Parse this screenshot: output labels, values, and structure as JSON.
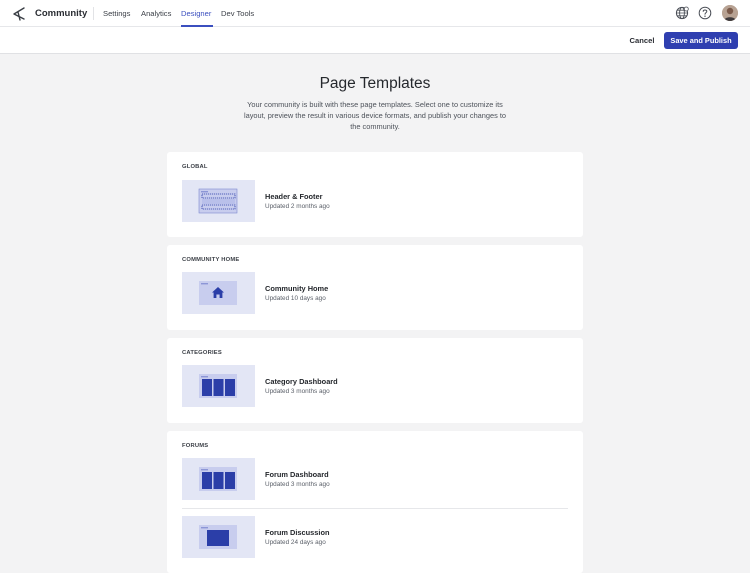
{
  "nav": {
    "brand": "Community",
    "tabs": [
      {
        "label": "Settings"
      },
      {
        "label": "Analytics"
      },
      {
        "label": "Designer"
      },
      {
        "label": "Dev Tools"
      }
    ]
  },
  "actions": {
    "cancel": "Cancel",
    "publish": "Save and Publish"
  },
  "page": {
    "title": "Page Templates",
    "description": "Your community is built with these page templates. Select one to customize its layout, preview the result in various device formats, and publish your changes to the community."
  },
  "sections": [
    {
      "label": "GLOBAL",
      "items": [
        {
          "name": "Header & Footer",
          "updated": "Updated 2 months ago",
          "thumb_icon": "header-footer-layout-icon"
        }
      ]
    },
    {
      "label": "COMMUNITY HOME",
      "items": [
        {
          "name": "Community Home",
          "updated": "Updated 10 days ago",
          "thumb_icon": "home-icon"
        }
      ]
    },
    {
      "label": "CATEGORIES",
      "items": [
        {
          "name": "Category Dashboard",
          "updated": "Updated 3 months ago",
          "thumb_icon": "three-column-layout-icon"
        }
      ]
    },
    {
      "label": "FORUMS",
      "items": [
        {
          "name": "Forum Dashboard",
          "updated": "Updated 3 months ago",
          "thumb_icon": "three-column-layout-icon"
        },
        {
          "name": "Forum Discussion",
          "updated": "Updated 24 days ago",
          "thumb_icon": "single-block-layout-icon"
        }
      ]
    }
  ],
  "colors": {
    "accent": "#3b4fbf",
    "button": "#2f3fb0",
    "thumb_bg": "#e3e6f5",
    "thumb_fg": "#2b3ea8",
    "page_bg": "#f3f3f4"
  }
}
